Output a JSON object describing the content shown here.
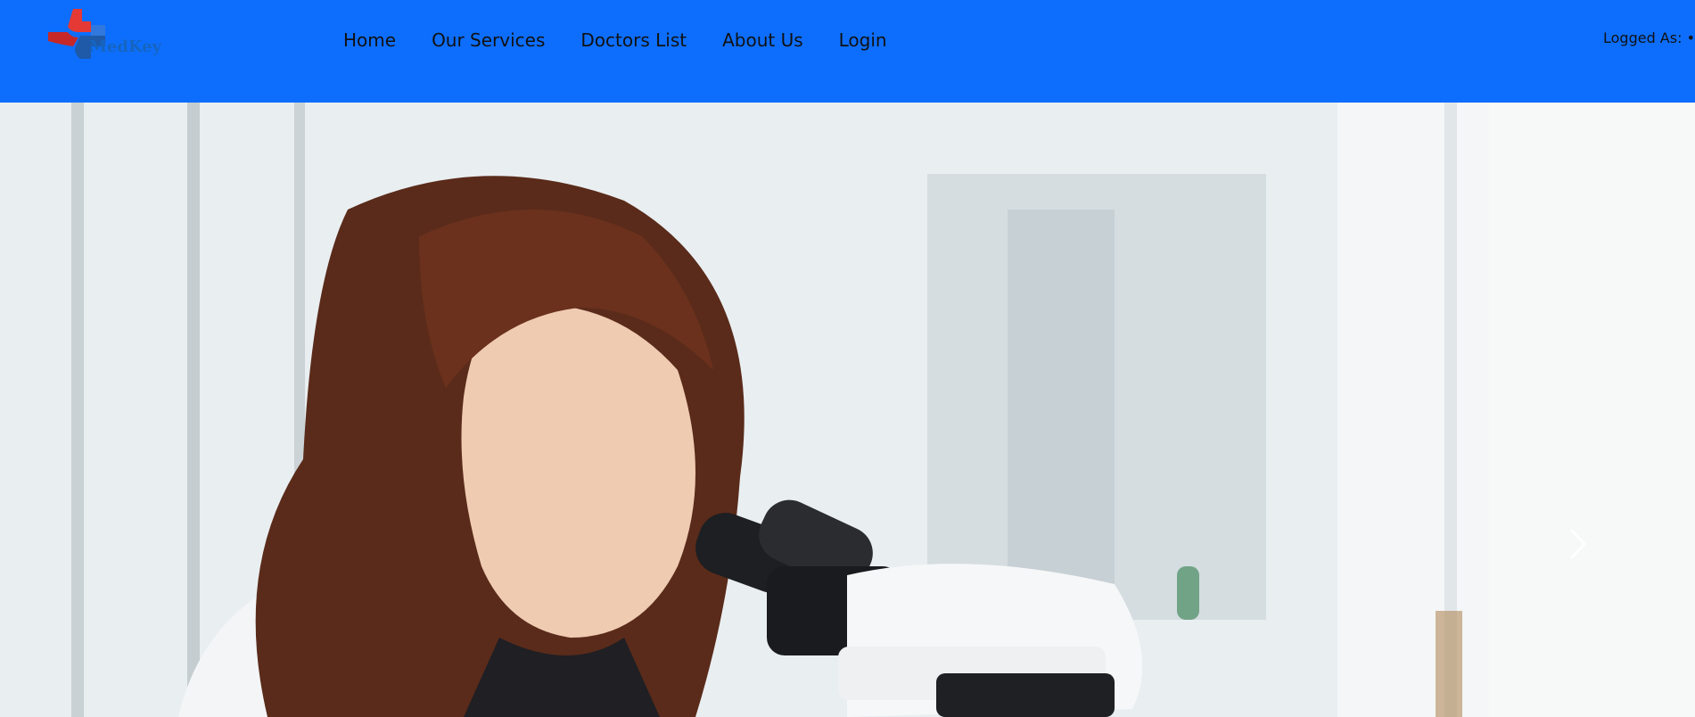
{
  "brand": {
    "logo_text": "MedKey",
    "colors": {
      "header_bg": "#0d6efd",
      "logo_red": "#e53935",
      "logo_blue": "#1565c0"
    }
  },
  "nav": {
    "items": [
      {
        "label": "Home"
      },
      {
        "label": "Our Services"
      },
      {
        "label": "Doctors List"
      },
      {
        "label": "About Us"
      },
      {
        "label": "Login"
      }
    ]
  },
  "user": {
    "logged_as_label": "Logged As: •"
  },
  "hero": {
    "image_name": "scientist-with-microscope",
    "next_icon": "chevron-right-icon"
  }
}
